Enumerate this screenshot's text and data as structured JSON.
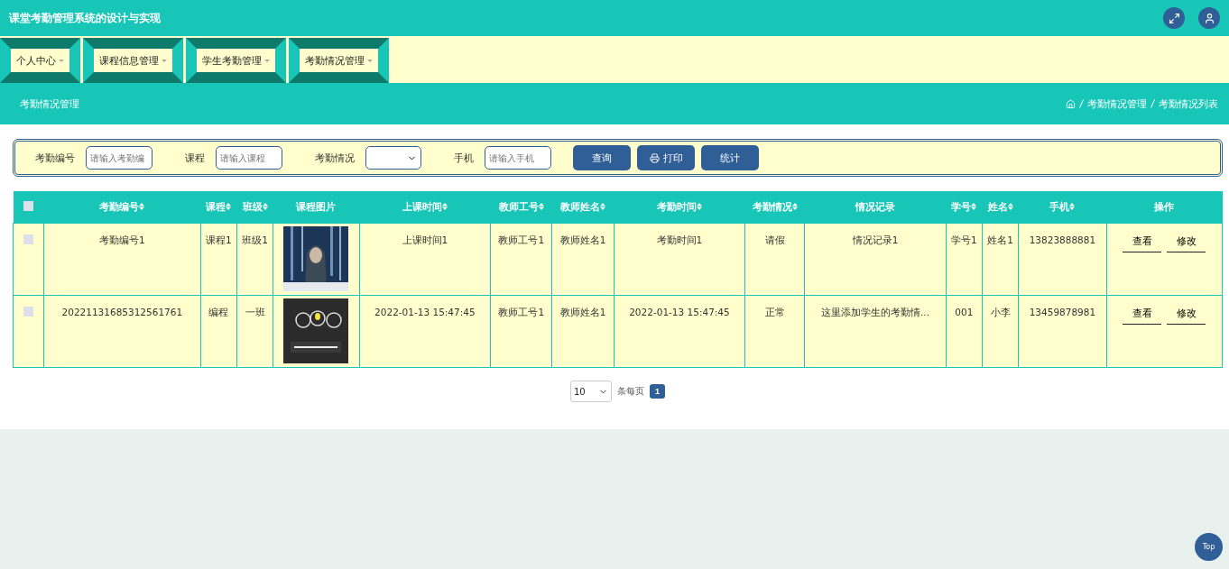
{
  "header": {
    "title": "课堂考勤管理系统的设计与实现"
  },
  "menu": [
    {
      "label": "个人中心"
    },
    {
      "label": "课程信息管理"
    },
    {
      "label": "学生考勤管理"
    },
    {
      "label": "考勤情况管理"
    }
  ],
  "section": {
    "title": "考勤情况管理",
    "breadcrumb": [
      "考勤情况管理",
      "考勤情况列表"
    ]
  },
  "search": {
    "fields": [
      {
        "kind": "input",
        "label": "考勤编号",
        "placeholder": "请输入考勤编"
      },
      {
        "kind": "input",
        "label": "课程",
        "placeholder": "请输入课程"
      },
      {
        "kind": "select",
        "label": "考勤情况"
      },
      {
        "kind": "input",
        "label": "手机",
        "placeholder": "请输入手机"
      }
    ],
    "buttons": [
      {
        "kind": "plain",
        "label": "查询"
      },
      {
        "kind": "print",
        "label": "打印"
      },
      {
        "kind": "plain",
        "label": "统计"
      }
    ]
  },
  "table": {
    "select_all": {
      "checked": false
    },
    "columns": [
      {
        "label": "考勤编号",
        "sortable": true
      },
      {
        "label": "课程",
        "sortable": true
      },
      {
        "label": "班级",
        "sortable": true
      },
      {
        "label": "课程图片",
        "sortable": false
      },
      {
        "label": "上课时间",
        "sortable": true
      },
      {
        "label": "教师工号",
        "sortable": true
      },
      {
        "label": "教师姓名",
        "sortable": true
      },
      {
        "label": "考勤时间",
        "sortable": true
      },
      {
        "label": "考勤情况",
        "sortable": true
      },
      {
        "label": "情况记录",
        "sortable": false
      },
      {
        "label": "学号",
        "sortable": true
      },
      {
        "label": "姓名",
        "sortable": true
      },
      {
        "label": "手机",
        "sortable": true
      },
      {
        "label": "操作",
        "sortable": false
      }
    ],
    "rows": [
      {
        "checked": false,
        "cells": [
          "考勤编号1",
          "课程1",
          "班级1",
          {
            "kind": "picture"
          },
          "上课时间1",
          "教师工号1",
          "教师姓名1",
          "考勤时间1",
          "请假",
          "情况记录1",
          "学号1",
          "姓名1",
          "13823888881"
        ],
        "actions": [
          "查看",
          "修改"
        ]
      },
      {
        "checked": false,
        "cells": [
          "20221131685312561761",
          "编程",
          "一班",
          {
            "kind": "picture"
          },
          "2022-01-13 15:47:45",
          "教师工号1",
          "教师姓名1",
          "2022-01-13 15:47:45",
          "正常",
          "这里添加学生的考勤情...",
          "001",
          "小李",
          "13459878981"
        ],
        "actions": [
          "查看",
          "修改"
        ]
      }
    ]
  },
  "pagination": {
    "page_size": "10",
    "per_page_label": "条每页",
    "pages": [
      {
        "label": "1",
        "selected": true
      }
    ]
  },
  "top_button": "Top"
}
